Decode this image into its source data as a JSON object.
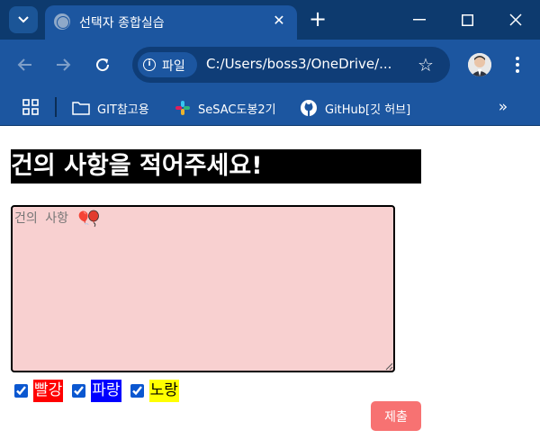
{
  "browser": {
    "tab": {
      "title": "선택자 종합실습"
    },
    "address": {
      "chip_label": "파일",
      "url": "C:/Users/boss3/OneDrive/..."
    },
    "bookmarks": [
      {
        "label": "GIT참고용",
        "icon": "folder-icon"
      },
      {
        "label": "SeSAC도봉2기",
        "icon": "slack-icon"
      },
      {
        "label": "GitHub[깃 허브]",
        "icon": "github-icon"
      }
    ],
    "bookmarks_overflow": "»"
  },
  "page": {
    "heading": "건의 사항을 적어주세요!",
    "textarea": {
      "placeholder": "건의 사항 🎈",
      "value": ""
    },
    "colors": [
      {
        "label": "빨강",
        "checked": true,
        "color": "#ff0000"
      },
      {
        "label": "파랑",
        "checked": true,
        "color": "#0000ff"
      },
      {
        "label": "노랑",
        "checked": true,
        "color": "#ffff00"
      }
    ],
    "submit_label": "제출"
  },
  "theme": {
    "chrome_dark": "#0d3a6e",
    "chrome_blue": "#1c56a0",
    "textarea_bg": "#f8d0d0",
    "submit_bg": "#f77272"
  }
}
